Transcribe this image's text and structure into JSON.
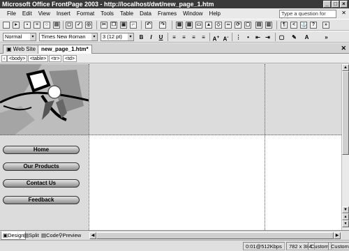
{
  "window": {
    "title": "Microsoft Office FrontPage 2003 - http://localhost/dwt/new_page_1.htm"
  },
  "menu": [
    "File",
    "Edit",
    "View",
    "Insert",
    "Format",
    "Tools",
    "Table",
    "Data",
    "Frames",
    "Window",
    "Help"
  ],
  "help_box": {
    "placeholder": "Type a question for help"
  },
  "format_toolbar": {
    "style": "Normal",
    "font": "Times New Roman",
    "size": "3  (12 pt)"
  },
  "tabs": [
    {
      "label": "Web Site"
    },
    {
      "label": "new_page_1.htm*"
    }
  ],
  "tag_selector": [
    "<body>",
    "<table>",
    "<tr>",
    "<td>"
  ],
  "nav_buttons": [
    "Home",
    "Our Products",
    "Contact Us",
    "Feedback"
  ],
  "view_tabs": [
    "Design",
    "Split",
    "Code",
    "Preview"
  ],
  "status": {
    "download": "0:01@512Kbps",
    "page_size": "782 x 384",
    "mode1": "Custom",
    "mode2": "Custom"
  }
}
